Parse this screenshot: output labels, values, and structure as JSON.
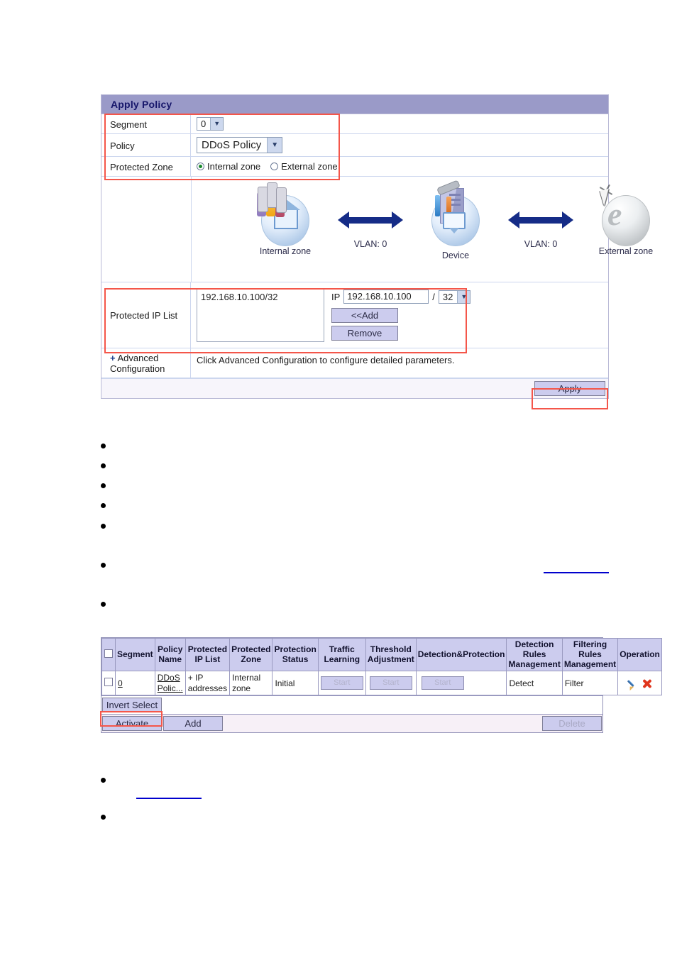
{
  "apply_policy_panel": {
    "title": "Apply Policy",
    "rows": {
      "segment": {
        "label": "Segment",
        "value": "0"
      },
      "policy": {
        "label": "Policy",
        "value": "DDoS Policy"
      },
      "protected_zone": {
        "label": "Protected Zone",
        "internal_label": "Internal zone",
        "external_label": "External zone",
        "selected": "Internal zone"
      },
      "protected_ip_list": {
        "label": "Protected IP List",
        "list_entries": [
          "192.168.10.100/32"
        ],
        "ip_field_label": "IP",
        "ip_value": "192.168.10.100",
        "slash": "/",
        "mask_value": "32",
        "add_button": "<<Add",
        "remove_button": "Remove"
      },
      "advanced": {
        "plus": "+",
        "label_line1": "Advanced",
        "label_line2": "Configuration",
        "description": "Click Advanced Configuration to configure detailed parameters."
      }
    },
    "apply_button": "Apply",
    "diagram": {
      "internal_zone_caption": "Internal zone",
      "device_caption": "Device",
      "external_zone_caption": "External zone",
      "vlan_left": "VLAN: 0",
      "vlan_right": "VLAN: 0"
    }
  },
  "policy_table": {
    "headers": [
      "",
      "Segment",
      "Policy Name",
      "Protected IP List",
      "Protected Zone",
      "Protection Status",
      "Traffic Learning",
      "Threshold Adjustment",
      "Detection&Protection",
      "Detection Rules Management",
      "Filtering Rules Management",
      "Operation"
    ],
    "header_lines": {
      "policy_name": [
        "Policy",
        "Name"
      ],
      "protected_ip_list": [
        "Protected",
        "IP List"
      ],
      "protected_zone": [
        "Protected",
        "Zone"
      ],
      "protection_status": [
        "Protection",
        "Status"
      ],
      "traffic_learning": [
        "Traffic",
        "Learning"
      ],
      "threshold_adjustment": [
        "Threshold",
        "Adjustment"
      ],
      "detection_protection": [
        "Detection&Protection"
      ],
      "detection_rules_management": [
        "Detection",
        "Rules",
        "Management"
      ],
      "filtering_rules_management": [
        "Filtering",
        "Rules",
        "Management"
      ],
      "operation": [
        "Operation"
      ],
      "segment": [
        "Segment"
      ]
    },
    "rows": [
      {
        "segment": "0",
        "policy_name": "DDoS Polic...",
        "policy_name_lines": [
          "DDoS",
          "Polic..."
        ],
        "protected_ip_list": "+ IP addresses",
        "protected_ip_list_lines": [
          "+ IP",
          "addresses"
        ],
        "protected_zone": "Internal zone",
        "protected_zone_lines": [
          "Internal",
          "zone"
        ],
        "protection_status": "Initial",
        "traffic_learning": "Start",
        "threshold_adjustment": "Start",
        "detection_protection": "Start",
        "detection_rules_management": "Detect",
        "filtering_rules_management": "Filter",
        "operation_icons": [
          "edit-pencil-icon",
          "delete-x-icon"
        ]
      }
    ],
    "toolbar": {
      "invert_select": "Invert Select",
      "activate": "Activate",
      "add": "Add",
      "delete": "Delete"
    }
  },
  "colors": {
    "panel_header_bg": "#9a9ac8",
    "panel_header_text": "#16166a",
    "table_header_bg": "#ccccee",
    "button_bg": "#ccccee",
    "annotation_red": "#f4564a",
    "link_blue": "#0000cd",
    "arrow_navy": "#152c87"
  },
  "bullet_list_top": [
    {
      "text": ""
    },
    {
      "text": ""
    },
    {
      "text": ""
    },
    {
      "text": ""
    },
    {
      "text": ""
    },
    {
      "text": ""
    },
    {
      "text": ""
    }
  ],
  "bullet_list_bottom": [
    {
      "text": ""
    },
    {
      "text": ""
    }
  ]
}
